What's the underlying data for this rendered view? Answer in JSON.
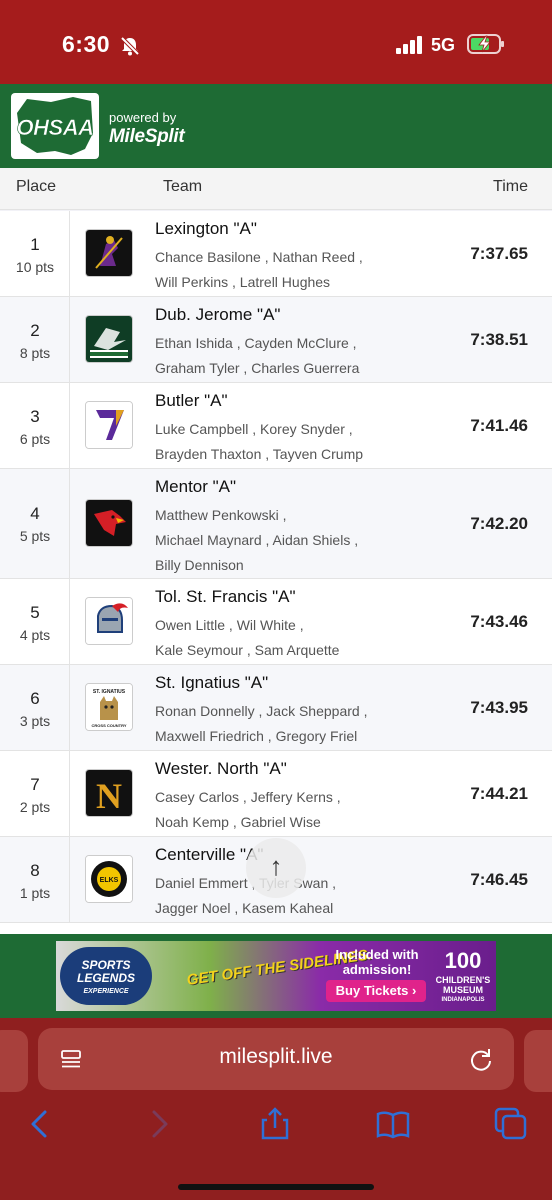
{
  "status_bar": {
    "time": "6:30",
    "network": "5G"
  },
  "header": {
    "logo": "OHSAA",
    "powered_by": "powered by",
    "brand": "MileSplit"
  },
  "columns": {
    "place": "Place",
    "team": "Team",
    "time": "Time"
  },
  "results": [
    {
      "place": "1",
      "pts": "10 pts",
      "team": "Lexington \"A\"",
      "runners_line1": "Chance Basilone , Nathan Reed ,",
      "runners_line2": "Will Perkins , Latrell Hughes",
      "runners_line3": "",
      "time": "7:37.65",
      "logo": "lexington-logo"
    },
    {
      "place": "2",
      "pts": "8 pts",
      "team": "Dub. Jerome \"A\"",
      "runners_line1": "Ethan Ishida , Cayden McClure ,",
      "runners_line2": "Graham Tyler , Charles Guerrera",
      "runners_line3": "",
      "time": "7:38.51",
      "logo": "celtics-logo"
    },
    {
      "place": "3",
      "pts": "6 pts",
      "team": "Butler \"A\"",
      "runners_line1": "Luke Campbell , Korey Snyder ,",
      "runners_line2": "Brayden Thaxton , Tayven Crump",
      "runners_line3": "",
      "time": "7:41.46",
      "logo": "butler-logo"
    },
    {
      "place": "4",
      "pts": "5 pts",
      "team": "Mentor \"A\"",
      "runners_line1": "Matthew Penkowski ,",
      "runners_line2": "Michael Maynard , Aidan Shiels ,",
      "runners_line3": "Billy Dennison",
      "time": "7:42.20",
      "logo": "cardinal-logo"
    },
    {
      "place": "5",
      "pts": "4 pts",
      "team": "Tol. St. Francis \"A\"",
      "runners_line1": "Owen Little , Wil White ,",
      "runners_line2": "Kale Seymour , Sam Arquette",
      "runners_line3": "",
      "time": "7:43.46",
      "logo": "knight-logo"
    },
    {
      "place": "6",
      "pts": "3 pts",
      "team": "St. Ignatius \"A\"",
      "runners_line1": "Ronan Donnelly , Jack Sheppard ,",
      "runners_line2": "Maxwell Friedrich , Gregory Friel",
      "runners_line3": "",
      "time": "7:43.95",
      "logo": "st-ignatius-logo",
      "logo_text_top": "ST. IGNATIUS",
      "logo_text_bottom": "CROSS COUNTRY"
    },
    {
      "place": "7",
      "pts": "2 pts",
      "team": "Wester. North \"A\"",
      "runners_line1": "Casey Carlos , Jeffery Kerns ,",
      "runners_line2": "Noah Kemp , Gabriel Wise",
      "runners_line3": "",
      "time": "7:44.21",
      "logo": "westerville-north-logo",
      "logo_letter": "N"
    },
    {
      "place": "8",
      "pts": "1 pts",
      "team": "Centerville \"A\"",
      "runners_line1": "Daniel Emmert , Tyler Swan ,",
      "runners_line2": "Jagger Noel , Kasem Kaheal",
      "runners_line3": "",
      "time": "7:46.45",
      "logo": "elks-logo",
      "logo_text": "ELKS"
    }
  ],
  "scroll_top": "↑",
  "ad": {
    "logo_line1": "SPORTS",
    "logo_line2": "LEGENDS",
    "logo_line3": "EXPERIENCE",
    "slogan": "GET OFF THE SIDELINES.",
    "included": "Included with admission!",
    "cta": "Buy Tickets ›",
    "museum_big": "100",
    "museum_small": "CHILDREN'S MUSEUM",
    "museum_city": "INDIANAPOLIS"
  },
  "browser": {
    "url": "milesplit.live"
  },
  "colors": {
    "status_red": "#a51c1c",
    "brand_green": "#1e6b34",
    "toolbar_red": "#8f1f1f",
    "toolbar_icon": "#2f6fd6"
  }
}
